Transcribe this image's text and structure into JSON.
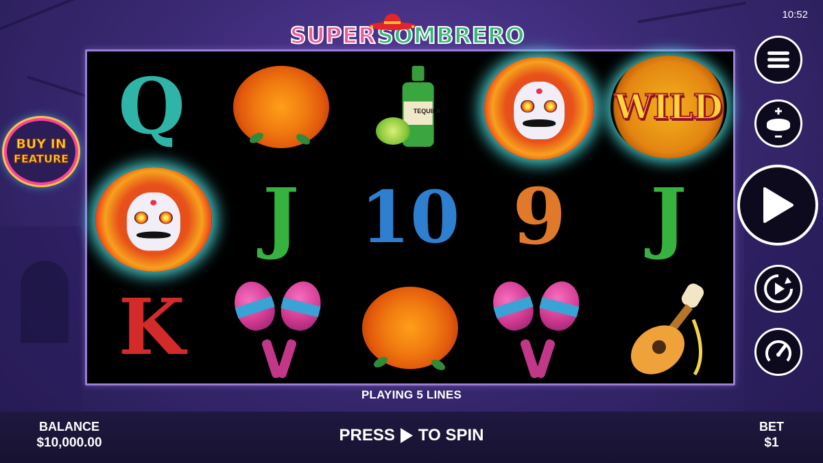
{
  "status": {
    "clock": "10:52"
  },
  "logo": {
    "part1": "SUPER",
    "part2": "SOMBRERO"
  },
  "buy_feature": {
    "line1": "BUY IN",
    "line2": "FEATURE"
  },
  "reels": {
    "symbols": [
      [
        "Q",
        "marigold",
        "tequila",
        "skull-wild-sombrero",
        "WILD"
      ],
      [
        "skull-wild-sombrero",
        "J",
        "10",
        "9",
        "J"
      ],
      [
        "K",
        "maracas",
        "marigold",
        "maracas",
        "guitar"
      ]
    ],
    "letter_colors": {
      "Q": "#2fb5a8",
      "J": "#36b33f",
      "10": "#2f7fd0",
      "9": "#e07a2a",
      "K": "#d32a2a"
    },
    "tequila_label": "TEQUILA",
    "wild_label": "WILD"
  },
  "lines": {
    "text": "PLAYING 5 LINES"
  },
  "footer": {
    "balance_label": "BALANCE",
    "balance_value": "$10,000.00",
    "press_text_1": "PRESS",
    "press_text_2": "TO SPIN",
    "bet_label": "BET",
    "bet_value": "$1"
  },
  "controls": [
    "menu-icon",
    "coin-stake-icon",
    "play-icon",
    "autoplay-icon",
    "speed-gauge-icon"
  ],
  "colors": {
    "reel_border": "#9a7fd6",
    "background": "#3b2a75",
    "glow": "#50e6e6"
  }
}
